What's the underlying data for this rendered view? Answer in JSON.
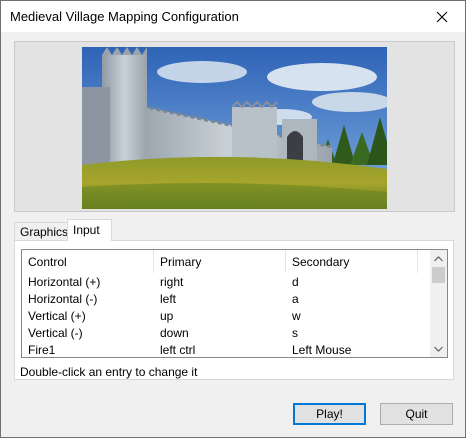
{
  "window": {
    "title": "Medieval Village Mapping Configuration"
  },
  "tabs": [
    {
      "label": "Graphics",
      "active": false
    },
    {
      "label": "Input",
      "active": true
    }
  ],
  "table": {
    "columns": [
      "Control",
      "Primary",
      "Secondary"
    ],
    "rows": [
      {
        "control": "Horizontal (+)",
        "primary": "right",
        "secondary": "d"
      },
      {
        "control": "Horizontal (-)",
        "primary": "left",
        "secondary": "a"
      },
      {
        "control": "Vertical (+)",
        "primary": "up",
        "secondary": "w"
      },
      {
        "control": "Vertical (-)",
        "primary": "down",
        "secondary": "s"
      },
      {
        "control": "Fire1",
        "primary": "left ctrl",
        "secondary": "Left Mouse"
      }
    ]
  },
  "hint": "Double-click an entry to change it",
  "buttons": {
    "play": "Play!",
    "quit": "Quit"
  },
  "icons": {
    "close": "close-icon",
    "scroll_up": "chevron-up-icon",
    "scroll_down": "chevron-down-icon"
  }
}
